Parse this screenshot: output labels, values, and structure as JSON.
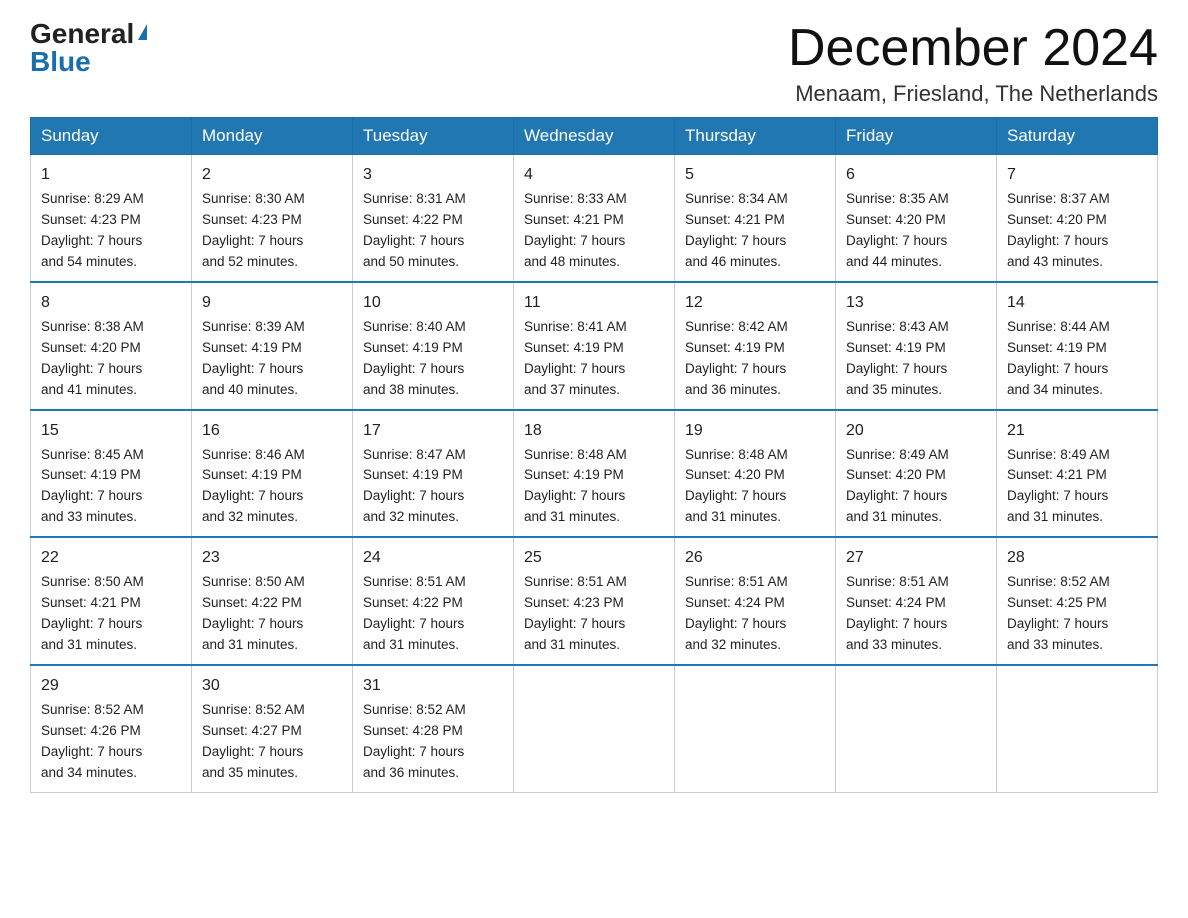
{
  "logo": {
    "general": "General",
    "blue": "Blue"
  },
  "title": "December 2024",
  "location": "Menaam, Friesland, The Netherlands",
  "weekdays": [
    "Sunday",
    "Monday",
    "Tuesday",
    "Wednesday",
    "Thursday",
    "Friday",
    "Saturday"
  ],
  "weeks": [
    [
      {
        "day": "1",
        "sunrise": "8:29 AM",
        "sunset": "4:23 PM",
        "daylight": "7 hours and 54 minutes."
      },
      {
        "day": "2",
        "sunrise": "8:30 AM",
        "sunset": "4:23 PM",
        "daylight": "7 hours and 52 minutes."
      },
      {
        "day": "3",
        "sunrise": "8:31 AM",
        "sunset": "4:22 PM",
        "daylight": "7 hours and 50 minutes."
      },
      {
        "day": "4",
        "sunrise": "8:33 AM",
        "sunset": "4:21 PM",
        "daylight": "7 hours and 48 minutes."
      },
      {
        "day": "5",
        "sunrise": "8:34 AM",
        "sunset": "4:21 PM",
        "daylight": "7 hours and 46 minutes."
      },
      {
        "day": "6",
        "sunrise": "8:35 AM",
        "sunset": "4:20 PM",
        "daylight": "7 hours and 44 minutes."
      },
      {
        "day": "7",
        "sunrise": "8:37 AM",
        "sunset": "4:20 PM",
        "daylight": "7 hours and 43 minutes."
      }
    ],
    [
      {
        "day": "8",
        "sunrise": "8:38 AM",
        "sunset": "4:20 PM",
        "daylight": "7 hours and 41 minutes."
      },
      {
        "day": "9",
        "sunrise": "8:39 AM",
        "sunset": "4:19 PM",
        "daylight": "7 hours and 40 minutes."
      },
      {
        "day": "10",
        "sunrise": "8:40 AM",
        "sunset": "4:19 PM",
        "daylight": "7 hours and 38 minutes."
      },
      {
        "day": "11",
        "sunrise": "8:41 AM",
        "sunset": "4:19 PM",
        "daylight": "7 hours and 37 minutes."
      },
      {
        "day": "12",
        "sunrise": "8:42 AM",
        "sunset": "4:19 PM",
        "daylight": "7 hours and 36 minutes."
      },
      {
        "day": "13",
        "sunrise": "8:43 AM",
        "sunset": "4:19 PM",
        "daylight": "7 hours and 35 minutes."
      },
      {
        "day": "14",
        "sunrise": "8:44 AM",
        "sunset": "4:19 PM",
        "daylight": "7 hours and 34 minutes."
      }
    ],
    [
      {
        "day": "15",
        "sunrise": "8:45 AM",
        "sunset": "4:19 PM",
        "daylight": "7 hours and 33 minutes."
      },
      {
        "day": "16",
        "sunrise": "8:46 AM",
        "sunset": "4:19 PM",
        "daylight": "7 hours and 32 minutes."
      },
      {
        "day": "17",
        "sunrise": "8:47 AM",
        "sunset": "4:19 PM",
        "daylight": "7 hours and 32 minutes."
      },
      {
        "day": "18",
        "sunrise": "8:48 AM",
        "sunset": "4:19 PM",
        "daylight": "7 hours and 31 minutes."
      },
      {
        "day": "19",
        "sunrise": "8:48 AM",
        "sunset": "4:20 PM",
        "daylight": "7 hours and 31 minutes."
      },
      {
        "day": "20",
        "sunrise": "8:49 AM",
        "sunset": "4:20 PM",
        "daylight": "7 hours and 31 minutes."
      },
      {
        "day": "21",
        "sunrise": "8:49 AM",
        "sunset": "4:21 PM",
        "daylight": "7 hours and 31 minutes."
      }
    ],
    [
      {
        "day": "22",
        "sunrise": "8:50 AM",
        "sunset": "4:21 PM",
        "daylight": "7 hours and 31 minutes."
      },
      {
        "day": "23",
        "sunrise": "8:50 AM",
        "sunset": "4:22 PM",
        "daylight": "7 hours and 31 minutes."
      },
      {
        "day": "24",
        "sunrise": "8:51 AM",
        "sunset": "4:22 PM",
        "daylight": "7 hours and 31 minutes."
      },
      {
        "day": "25",
        "sunrise": "8:51 AM",
        "sunset": "4:23 PM",
        "daylight": "7 hours and 31 minutes."
      },
      {
        "day": "26",
        "sunrise": "8:51 AM",
        "sunset": "4:24 PM",
        "daylight": "7 hours and 32 minutes."
      },
      {
        "day": "27",
        "sunrise": "8:51 AM",
        "sunset": "4:24 PM",
        "daylight": "7 hours and 33 minutes."
      },
      {
        "day": "28",
        "sunrise": "8:52 AM",
        "sunset": "4:25 PM",
        "daylight": "7 hours and 33 minutes."
      }
    ],
    [
      {
        "day": "29",
        "sunrise": "8:52 AM",
        "sunset": "4:26 PM",
        "daylight": "7 hours and 34 minutes."
      },
      {
        "day": "30",
        "sunrise": "8:52 AM",
        "sunset": "4:27 PM",
        "daylight": "7 hours and 35 minutes."
      },
      {
        "day": "31",
        "sunrise": "8:52 AM",
        "sunset": "4:28 PM",
        "daylight": "7 hours and 36 minutes."
      },
      null,
      null,
      null,
      null
    ]
  ],
  "labels": {
    "sunrise": "Sunrise:",
    "sunset": "Sunset:",
    "daylight": "Daylight:"
  }
}
